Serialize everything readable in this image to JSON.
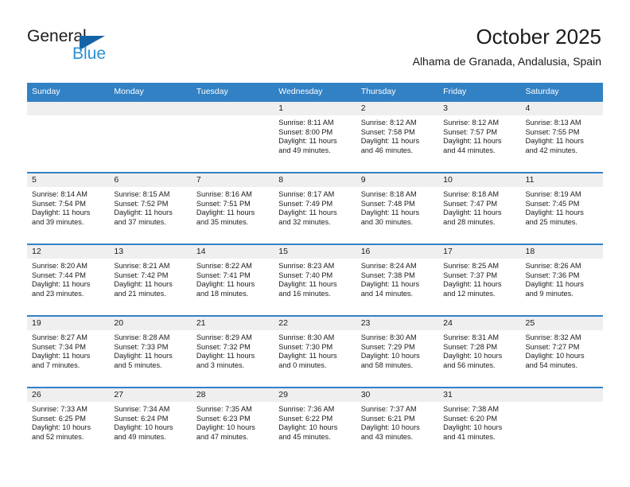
{
  "brand": {
    "name_part1": "General",
    "name_part2": "Blue",
    "logo_icon": "flag-triangle-icon",
    "accent_color": "#2d8fd5",
    "flag_color": "#1464a5"
  },
  "header": {
    "title": "October 2025",
    "subtitle": "Alhama de Granada, Andalusia, Spain"
  },
  "calendar": {
    "header_bg": "#3281c4",
    "daynum_bg": "#efefef",
    "weekday_headers": [
      "Sunday",
      "Monday",
      "Tuesday",
      "Wednesday",
      "Thursday",
      "Friday",
      "Saturday"
    ],
    "weeks": [
      [
        {
          "day": "",
          "sunrise": "",
          "sunset": "",
          "daylight_line1": "",
          "daylight_line2": ""
        },
        {
          "day": "",
          "sunrise": "",
          "sunset": "",
          "daylight_line1": "",
          "daylight_line2": ""
        },
        {
          "day": "",
          "sunrise": "",
          "sunset": "",
          "daylight_line1": "",
          "daylight_line2": ""
        },
        {
          "day": "1",
          "sunrise": "Sunrise: 8:11 AM",
          "sunset": "Sunset: 8:00 PM",
          "daylight_line1": "Daylight: 11 hours",
          "daylight_line2": "and 49 minutes."
        },
        {
          "day": "2",
          "sunrise": "Sunrise: 8:12 AM",
          "sunset": "Sunset: 7:58 PM",
          "daylight_line1": "Daylight: 11 hours",
          "daylight_line2": "and 46 minutes."
        },
        {
          "day": "3",
          "sunrise": "Sunrise: 8:12 AM",
          "sunset": "Sunset: 7:57 PM",
          "daylight_line1": "Daylight: 11 hours",
          "daylight_line2": "and 44 minutes."
        },
        {
          "day": "4",
          "sunrise": "Sunrise: 8:13 AM",
          "sunset": "Sunset: 7:55 PM",
          "daylight_line1": "Daylight: 11 hours",
          "daylight_line2": "and 42 minutes."
        }
      ],
      [
        {
          "day": "5",
          "sunrise": "Sunrise: 8:14 AM",
          "sunset": "Sunset: 7:54 PM",
          "daylight_line1": "Daylight: 11 hours",
          "daylight_line2": "and 39 minutes."
        },
        {
          "day": "6",
          "sunrise": "Sunrise: 8:15 AM",
          "sunset": "Sunset: 7:52 PM",
          "daylight_line1": "Daylight: 11 hours",
          "daylight_line2": "and 37 minutes."
        },
        {
          "day": "7",
          "sunrise": "Sunrise: 8:16 AM",
          "sunset": "Sunset: 7:51 PM",
          "daylight_line1": "Daylight: 11 hours",
          "daylight_line2": "and 35 minutes."
        },
        {
          "day": "8",
          "sunrise": "Sunrise: 8:17 AM",
          "sunset": "Sunset: 7:49 PM",
          "daylight_line1": "Daylight: 11 hours",
          "daylight_line2": "and 32 minutes."
        },
        {
          "day": "9",
          "sunrise": "Sunrise: 8:18 AM",
          "sunset": "Sunset: 7:48 PM",
          "daylight_line1": "Daylight: 11 hours",
          "daylight_line2": "and 30 minutes."
        },
        {
          "day": "10",
          "sunrise": "Sunrise: 8:18 AM",
          "sunset": "Sunset: 7:47 PM",
          "daylight_line1": "Daylight: 11 hours",
          "daylight_line2": "and 28 minutes."
        },
        {
          "day": "11",
          "sunrise": "Sunrise: 8:19 AM",
          "sunset": "Sunset: 7:45 PM",
          "daylight_line1": "Daylight: 11 hours",
          "daylight_line2": "and 25 minutes."
        }
      ],
      [
        {
          "day": "12",
          "sunrise": "Sunrise: 8:20 AM",
          "sunset": "Sunset: 7:44 PM",
          "daylight_line1": "Daylight: 11 hours",
          "daylight_line2": "and 23 minutes."
        },
        {
          "day": "13",
          "sunrise": "Sunrise: 8:21 AM",
          "sunset": "Sunset: 7:42 PM",
          "daylight_line1": "Daylight: 11 hours",
          "daylight_line2": "and 21 minutes."
        },
        {
          "day": "14",
          "sunrise": "Sunrise: 8:22 AM",
          "sunset": "Sunset: 7:41 PM",
          "daylight_line1": "Daylight: 11 hours",
          "daylight_line2": "and 18 minutes."
        },
        {
          "day": "15",
          "sunrise": "Sunrise: 8:23 AM",
          "sunset": "Sunset: 7:40 PM",
          "daylight_line1": "Daylight: 11 hours",
          "daylight_line2": "and 16 minutes."
        },
        {
          "day": "16",
          "sunrise": "Sunrise: 8:24 AM",
          "sunset": "Sunset: 7:38 PM",
          "daylight_line1": "Daylight: 11 hours",
          "daylight_line2": "and 14 minutes."
        },
        {
          "day": "17",
          "sunrise": "Sunrise: 8:25 AM",
          "sunset": "Sunset: 7:37 PM",
          "daylight_line1": "Daylight: 11 hours",
          "daylight_line2": "and 12 minutes."
        },
        {
          "day": "18",
          "sunrise": "Sunrise: 8:26 AM",
          "sunset": "Sunset: 7:36 PM",
          "daylight_line1": "Daylight: 11 hours",
          "daylight_line2": "and 9 minutes."
        }
      ],
      [
        {
          "day": "19",
          "sunrise": "Sunrise: 8:27 AM",
          "sunset": "Sunset: 7:34 PM",
          "daylight_line1": "Daylight: 11 hours",
          "daylight_line2": "and 7 minutes."
        },
        {
          "day": "20",
          "sunrise": "Sunrise: 8:28 AM",
          "sunset": "Sunset: 7:33 PM",
          "daylight_line1": "Daylight: 11 hours",
          "daylight_line2": "and 5 minutes."
        },
        {
          "day": "21",
          "sunrise": "Sunrise: 8:29 AM",
          "sunset": "Sunset: 7:32 PM",
          "daylight_line1": "Daylight: 11 hours",
          "daylight_line2": "and 3 minutes."
        },
        {
          "day": "22",
          "sunrise": "Sunrise: 8:30 AM",
          "sunset": "Sunset: 7:30 PM",
          "daylight_line1": "Daylight: 11 hours",
          "daylight_line2": "and 0 minutes."
        },
        {
          "day": "23",
          "sunrise": "Sunrise: 8:30 AM",
          "sunset": "Sunset: 7:29 PM",
          "daylight_line1": "Daylight: 10 hours",
          "daylight_line2": "and 58 minutes."
        },
        {
          "day": "24",
          "sunrise": "Sunrise: 8:31 AM",
          "sunset": "Sunset: 7:28 PM",
          "daylight_line1": "Daylight: 10 hours",
          "daylight_line2": "and 56 minutes."
        },
        {
          "day": "25",
          "sunrise": "Sunrise: 8:32 AM",
          "sunset": "Sunset: 7:27 PM",
          "daylight_line1": "Daylight: 10 hours",
          "daylight_line2": "and 54 minutes."
        }
      ],
      [
        {
          "day": "26",
          "sunrise": "Sunrise: 7:33 AM",
          "sunset": "Sunset: 6:25 PM",
          "daylight_line1": "Daylight: 10 hours",
          "daylight_line2": "and 52 minutes."
        },
        {
          "day": "27",
          "sunrise": "Sunrise: 7:34 AM",
          "sunset": "Sunset: 6:24 PM",
          "daylight_line1": "Daylight: 10 hours",
          "daylight_line2": "and 49 minutes."
        },
        {
          "day": "28",
          "sunrise": "Sunrise: 7:35 AM",
          "sunset": "Sunset: 6:23 PM",
          "daylight_line1": "Daylight: 10 hours",
          "daylight_line2": "and 47 minutes."
        },
        {
          "day": "29",
          "sunrise": "Sunrise: 7:36 AM",
          "sunset": "Sunset: 6:22 PM",
          "daylight_line1": "Daylight: 10 hours",
          "daylight_line2": "and 45 minutes."
        },
        {
          "day": "30",
          "sunrise": "Sunrise: 7:37 AM",
          "sunset": "Sunset: 6:21 PM",
          "daylight_line1": "Daylight: 10 hours",
          "daylight_line2": "and 43 minutes."
        },
        {
          "day": "31",
          "sunrise": "Sunrise: 7:38 AM",
          "sunset": "Sunset: 6:20 PM",
          "daylight_line1": "Daylight: 10 hours",
          "daylight_line2": "and 41 minutes."
        },
        {
          "day": "",
          "sunrise": "",
          "sunset": "",
          "daylight_line1": "",
          "daylight_line2": ""
        }
      ]
    ]
  }
}
